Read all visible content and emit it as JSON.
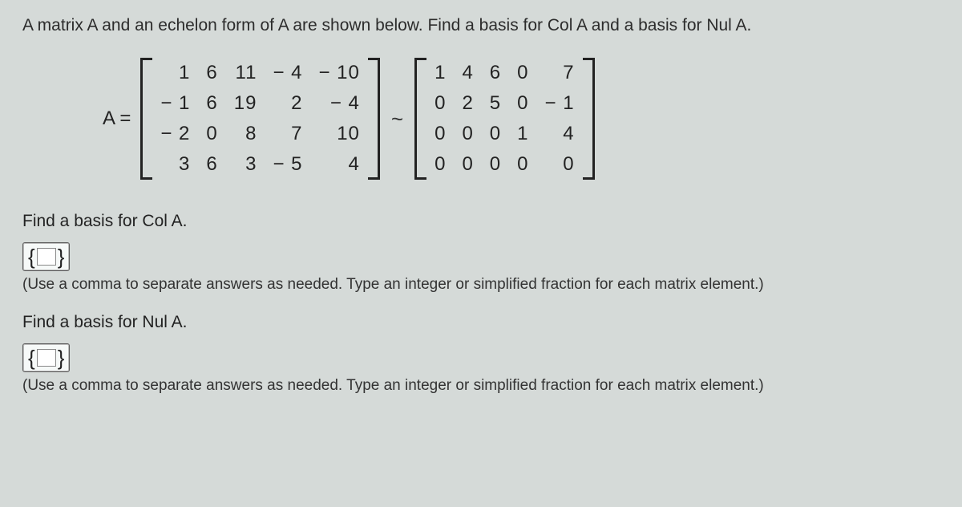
{
  "question": "A matrix A and an echelon form of A are shown below. Find a basis for Col A and a basis for Nul A.",
  "label_A": "A =",
  "tilde": "~",
  "matrixA": [
    [
      "1",
      "6",
      "11",
      "− 4",
      "− 10"
    ],
    [
      "− 1",
      "6",
      "19",
      "2",
      "− 4"
    ],
    [
      "− 2",
      "0",
      "8",
      "7",
      "10"
    ],
    [
      "3",
      "6",
      "3",
      "− 5",
      "4"
    ]
  ],
  "matrixE": [
    [
      "1",
      "4",
      "6",
      "0",
      "7"
    ],
    [
      "0",
      "2",
      "5",
      "0",
      "− 1"
    ],
    [
      "0",
      "0",
      "0",
      "1",
      "4"
    ],
    [
      "0",
      "0",
      "0",
      "0",
      "0"
    ]
  ],
  "prompt_col": "Find a basis for Col A.",
  "prompt_nul": "Find a basis for Nul A.",
  "hint": "(Use a comma to separate answers as needed. Type an integer or simplified fraction for each matrix element.)"
}
